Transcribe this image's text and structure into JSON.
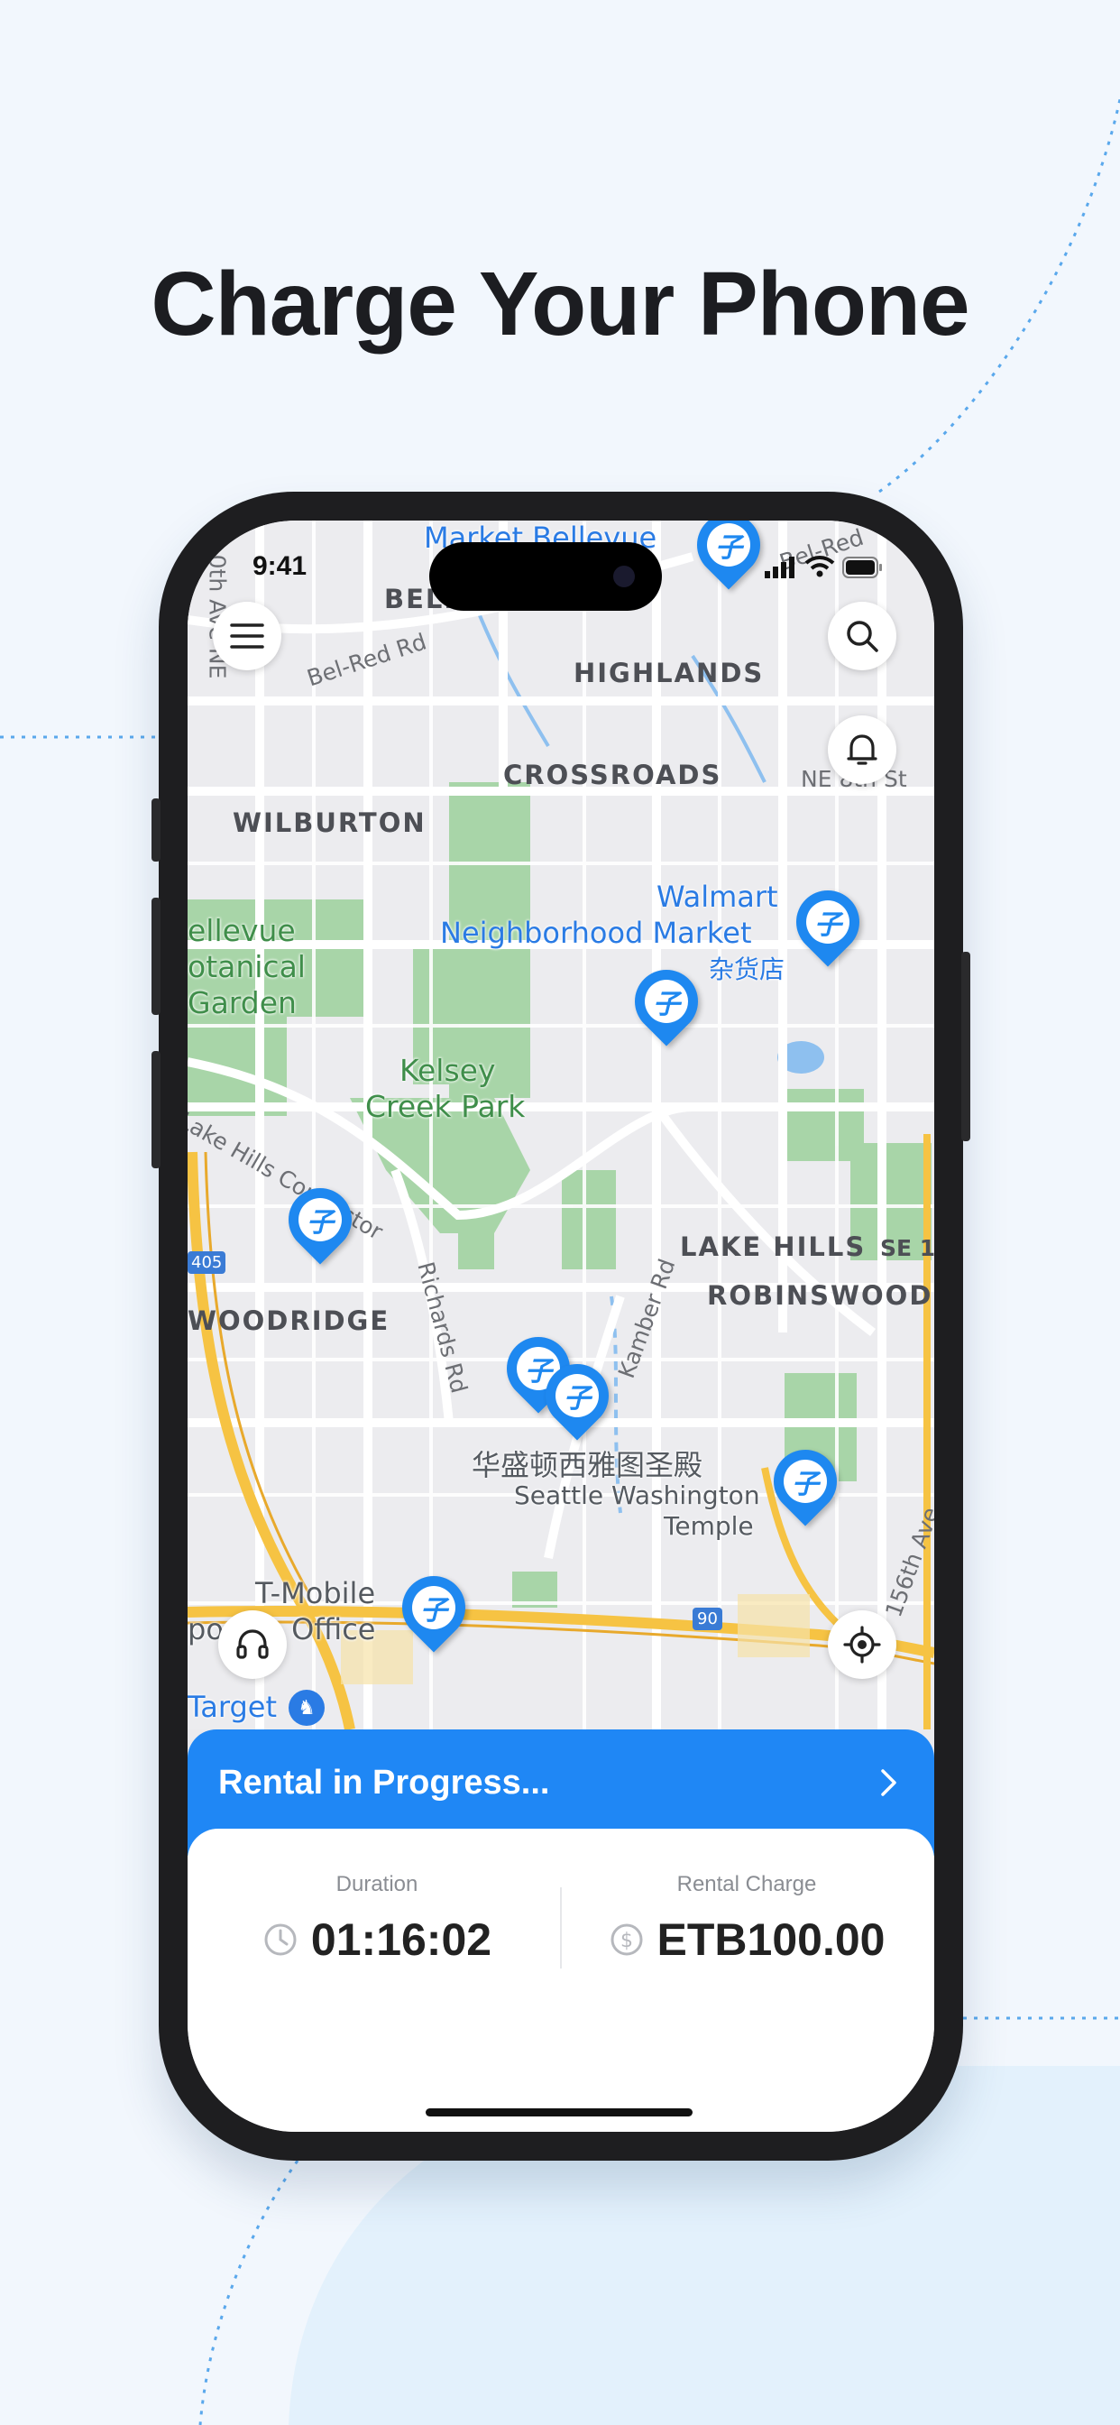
{
  "headline": "Charge Your Phone",
  "status_bar": {
    "time": "9:41"
  },
  "map": {
    "districts": [
      "BELLEVUE",
      "HIGHLANDS",
      "CROSSROADS",
      "WILBURTON",
      "LAKE HILLS",
      "ROBINSWOOD",
      "WOODRIDGE"
    ],
    "places": {
      "market_bellevue": "Market Bellevue",
      "walmart_1": "Walmart",
      "walmart_2": "Neighborhood Market",
      "walmart_cn": "杂货店",
      "botanical_1": "ellevue",
      "botanical_2": "otanical",
      "botanical_3": "Garden",
      "kelsey_1": "Kelsey",
      "kelsey_2": "Creek Park",
      "temple_cn": "华盛顿西雅图圣殿",
      "temple_1": "Seattle Washington",
      "temple_2": "Temple",
      "tmobile_1": "T-Mobile",
      "tmobile_2": "porate Office",
      "target": "Target"
    },
    "roads": {
      "bel_red": "Bel-Red Rd",
      "bel_red_2": "Bel-Red",
      "ave_ne": "0th Ave NE",
      "ne_st": "NE 8th St",
      "lake_hills": "Lake Hills Connector",
      "richards": "Richards Rd",
      "kamber": "Kamber Rd",
      "se1": "SE 1",
      "ave_156": "156th Ave",
      "hwy_405": "405",
      "hwy_90": "90"
    }
  },
  "banner": {
    "label": "Rental in Progress..."
  },
  "rental": {
    "duration_label": "Duration",
    "duration_value": "01:16:02",
    "charge_label": "Rental Charge",
    "charge_value": "ETB100.00"
  },
  "colors": {
    "accent": "#1f87f5",
    "background": "#f2f7fd"
  },
  "icons": [
    "menu-icon",
    "search-icon",
    "bell-icon",
    "headset-icon",
    "locate-icon",
    "chevron-right-icon",
    "clock-icon",
    "coin-icon",
    "station-pin-icon"
  ]
}
